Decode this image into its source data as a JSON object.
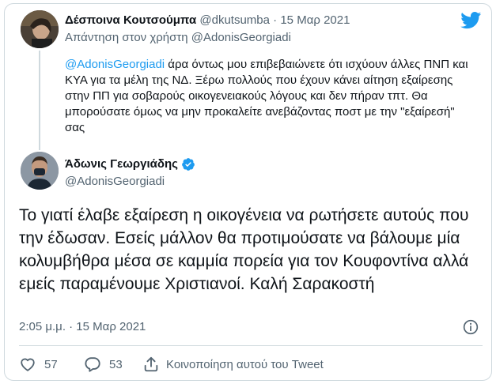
{
  "reply": {
    "name": "Δέσποινα Κουτσούμπα",
    "handle": "@dkutsumba",
    "separator": "·",
    "date": "15 Μαρ 2021",
    "replying_to_prefix": "Απάντηση στον χρήστη",
    "replying_to_handle": "@AdonisGeorgiadi",
    "text_mention": "@AdonisGeorgiadi",
    "text_body": " άρα όντως μου επιβεβαιώνετε ότι ισχύουν άλλες ΠΝΠ και ΚΥΑ για τα μέλη της ΝΔ. Ξέρω πολλούς που έχουν κάνει αίτηση εξαίρεσης στην ΠΠ για σοβαρούς οικογενειακούς λόγους και δεν πήραν τπτ. Θα μπορούσατε όμως να μην προκαλείτε ανεβάζοντας ποστ με την \"εξαίρεσή\" σας"
  },
  "main": {
    "name": "Άδωνις Γεωργιάδης",
    "handle": "@AdonisGeorgiadi",
    "text": "Το γιατί έλαβε εξαίρεση η οικογένεια να ρωτήσετε αυτούς που την έδωσαν. Εσείς μάλλον θα προτιμούσατε να βάλουμε μία κολυμβήθρα μέσα σε καμμία πορεία για τον Κουφοντίνα αλλά εμείς παραμένουμε Χριστιανοί. Καλή Σαρακοστή",
    "timestamp": "2:05 μ.μ. · 15 Μαρ 2021"
  },
  "actions": {
    "likes": "57",
    "replies": "53",
    "share_label": "Κοινοποίηση αυτού του Tweet"
  },
  "colors": {
    "accent": "#1d9bf0",
    "secondary_text": "#536471",
    "border": "#cfd9de"
  },
  "icons": [
    "twitter-logo-icon",
    "verified-badge-icon",
    "info-icon",
    "heart-icon",
    "comment-icon",
    "share-icon"
  ]
}
